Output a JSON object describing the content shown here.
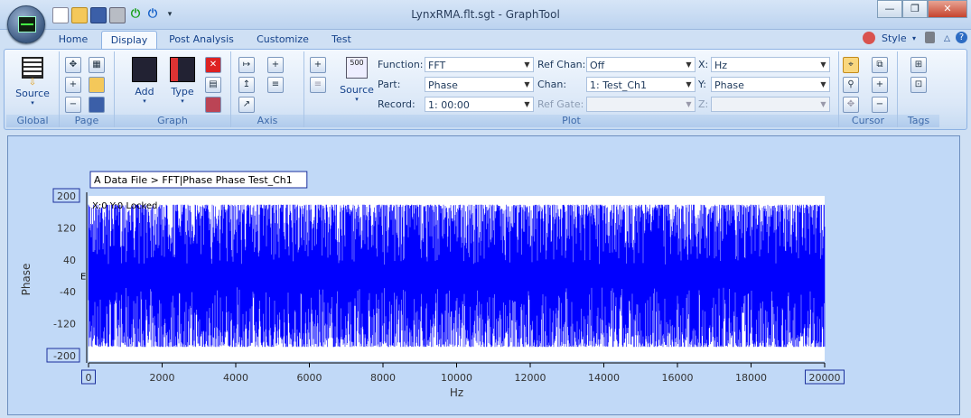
{
  "window": {
    "title": "LynxRMA.flt.sgt - GraphTool"
  },
  "qat": [
    "new-icon",
    "open-icon",
    "save-icon",
    "print-icon",
    "power-on-icon",
    "power-off-icon",
    "customize-qat-icon"
  ],
  "win_controls": {
    "minimize": "—",
    "restore": "❐",
    "close": "✕"
  },
  "tabs": [
    "Home",
    "Display",
    "Post Analysis",
    "Customize",
    "Test"
  ],
  "active_tab": "Display",
  "right_tools": {
    "style_label": "Style"
  },
  "groups": {
    "global": {
      "label": "Global",
      "source_label": "Source"
    },
    "page": {
      "label": "Page"
    },
    "graph": {
      "label": "Graph",
      "add_label": "Add",
      "type_label": "Type"
    },
    "axis": {
      "label": "Axis"
    },
    "plot": {
      "label": "Plot",
      "source_label": "Source",
      "source_badge": "500",
      "function_label": "Function:",
      "function_value": "FFT",
      "part_label": "Part:",
      "part_value": "Phase",
      "record_label": "Record:",
      "record_value": "1: 00:00",
      "refchan_label": "Ref Chan:",
      "refchan_value": "Off",
      "chan_label": "Chan:",
      "chan_value": "1: Test_Ch1",
      "refgate_label": "Ref Gate:",
      "refgate_value": "",
      "x_label": "X:",
      "x_value": "Hz",
      "y_label": "Y:",
      "y_value": "Phase",
      "z_label": "Z:",
      "z_value": ""
    },
    "cursor": {
      "label": "Cursor"
    },
    "tags": {
      "label": "Tags"
    }
  },
  "plot_area": {
    "title_box": "A Data File > FFT|Phase Phase Test_Ch1",
    "locked_text": "X:0 Y:0 Locked",
    "y_marker": "E"
  },
  "chart_data": {
    "type": "line",
    "title": "A Data File > FFT|Phase Phase Test_Ch1",
    "xlabel": "Hz",
    "ylabel": "Phase",
    "xlim": [
      0,
      20000
    ],
    "ylim": [
      -200,
      200
    ],
    "x_ticks": [
      0,
      2000,
      4000,
      6000,
      8000,
      10000,
      12000,
      14000,
      16000,
      18000,
      20000
    ],
    "y_ticks": [
      200,
      120,
      40,
      -40,
      -120,
      -200
    ],
    "series": [
      {
        "color": "#0000ff",
        "description": "dense phase noise spanning approximately -180 to 180 across 0-20000 Hz"
      }
    ],
    "grid": false,
    "background": "#ffffff"
  }
}
